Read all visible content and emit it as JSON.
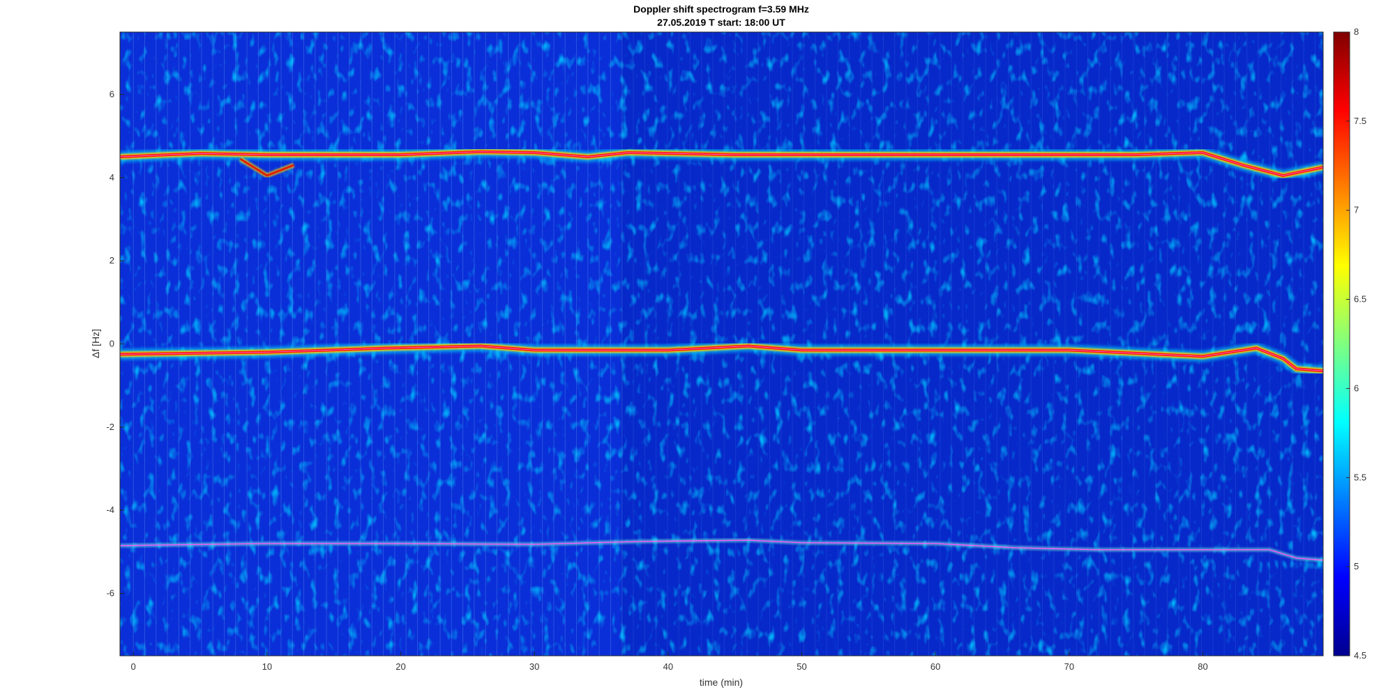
{
  "chart_data": {
    "type": "heatmap",
    "title": "Doppler shift spectrogram f=3.59 MHz",
    "subtitle": "27.05.2019   T start: 18:00 UT",
    "xlabel": "time (min)",
    "ylabel": "Δf [Hz]",
    "xlim": [
      -1,
      89
    ],
    "ylim": [
      -7.5,
      7.5
    ],
    "xticks": [
      0,
      10,
      20,
      30,
      40,
      50,
      60,
      70,
      80
    ],
    "yticks": [
      -6,
      -4,
      -2,
      0,
      2,
      4,
      6
    ],
    "colorbar": {
      "colormap": "jet",
      "range": [
        4.5,
        8
      ],
      "ticks": [
        4.5,
        5,
        5.5,
        6,
        6.5,
        7,
        7.5,
        8
      ]
    },
    "traces": [
      {
        "strength": "strong",
        "points": [
          [
            -1,
            4.5
          ],
          [
            5,
            4.58
          ],
          [
            10,
            4.55
          ],
          [
            20,
            4.55
          ],
          [
            26,
            4.62
          ],
          [
            30,
            4.6
          ],
          [
            34,
            4.5
          ],
          [
            37,
            4.6
          ],
          [
            45,
            4.55
          ],
          [
            55,
            4.55
          ],
          [
            65,
            4.55
          ],
          [
            75,
            4.55
          ],
          [
            80,
            4.6
          ],
          [
            83,
            4.3
          ],
          [
            86,
            4.05
          ],
          [
            89,
            4.25
          ]
        ]
      },
      {
        "strength": "weak",
        "points": [
          [
            8,
            4.45
          ],
          [
            10,
            4.05
          ],
          [
            12,
            4.3
          ]
        ]
      },
      {
        "strength": "strong",
        "points": [
          [
            -1,
            -0.25
          ],
          [
            10,
            -0.2
          ],
          [
            19,
            -0.1
          ],
          [
            26,
            -0.05
          ],
          [
            30,
            -0.15
          ],
          [
            40,
            -0.15
          ],
          [
            46,
            -0.05
          ],
          [
            50,
            -0.15
          ],
          [
            60,
            -0.15
          ],
          [
            70,
            -0.15
          ],
          [
            80,
            -0.3
          ],
          [
            84,
            -0.1
          ],
          [
            86,
            -0.35
          ],
          [
            87,
            -0.6
          ],
          [
            89,
            -0.65
          ]
        ]
      },
      {
        "strength": "faint",
        "points": [
          [
            -1,
            -4.85
          ],
          [
            10,
            -4.8
          ],
          [
            20,
            -4.8
          ],
          [
            30,
            -4.82
          ],
          [
            38,
            -4.75
          ],
          [
            46,
            -4.72
          ],
          [
            50,
            -4.78
          ],
          [
            60,
            -4.8
          ],
          [
            66,
            -4.9
          ],
          [
            72,
            -4.95
          ],
          [
            80,
            -4.95
          ],
          [
            85,
            -4.95
          ],
          [
            87,
            -5.15
          ],
          [
            89,
            -5.2
          ]
        ]
      }
    ]
  }
}
